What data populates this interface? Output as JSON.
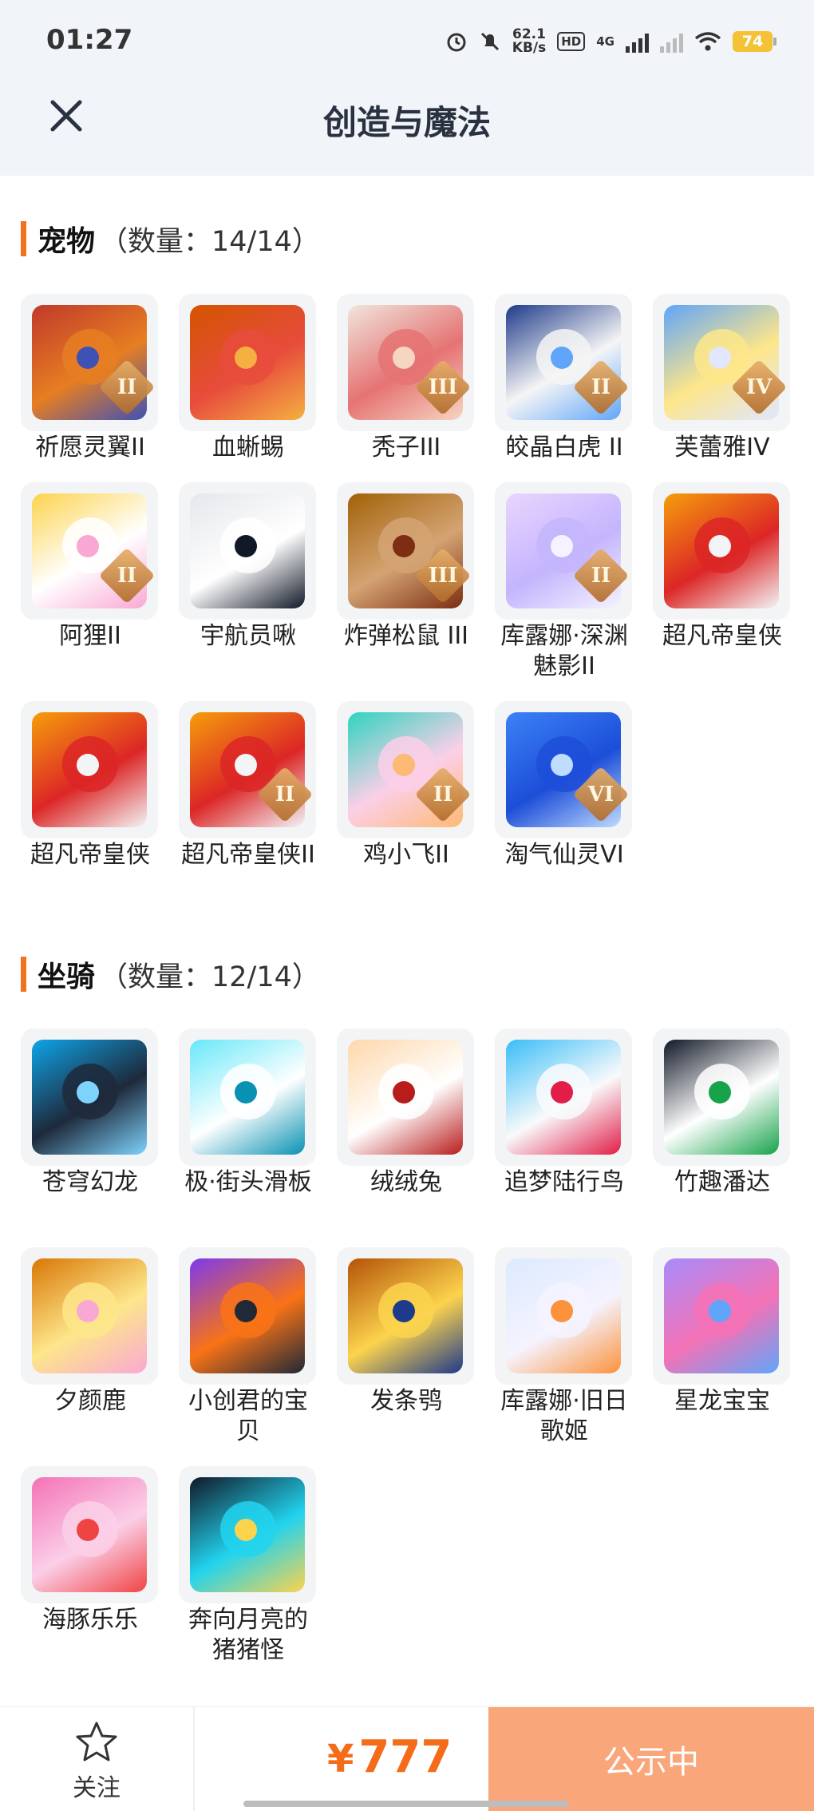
{
  "status_bar": {
    "time": "01:27",
    "net_speed_value": "62.1",
    "net_speed_unit": "KB/s",
    "hd_badge": "HD",
    "network": "4G",
    "battery": "74"
  },
  "header": {
    "title": "创造与魔法",
    "close_icon": "close-icon"
  },
  "pets": {
    "name": "宠物",
    "count_label": "（数量：14/14）",
    "items": [
      {
        "name": "祈愿灵翼II",
        "tier": "II",
        "colors": [
          "#c0392b",
          "#e67e22",
          "#3f51b5"
        ]
      },
      {
        "name": "血蜥蜴",
        "tier": "",
        "colors": [
          "#d35400",
          "#e74c3c",
          "#f5b041"
        ]
      },
      {
        "name": "秃子III",
        "tier": "III",
        "colors": [
          "#f0e6dc",
          "#e57373",
          "#f6d5c1"
        ]
      },
      {
        "name": "皎晶白虎 II",
        "tier": "II",
        "colors": [
          "#1e3a8a",
          "#f5f5f5",
          "#60a5fa"
        ]
      },
      {
        "name": "芙蕾雅IV",
        "tier": "IV",
        "colors": [
          "#60a5fa",
          "#fde68a",
          "#e0e7ff"
        ]
      },
      {
        "name": "阿狸II",
        "tier": "II",
        "colors": [
          "#fcd34d",
          "#ffffff",
          "#f9a8d4"
        ]
      },
      {
        "name": "宇航员啾",
        "tier": "",
        "colors": [
          "#e5e7eb",
          "#ffffff",
          "#111827"
        ]
      },
      {
        "name": "炸弹松鼠 III",
        "tier": "III",
        "colors": [
          "#a16207",
          "#d4a373",
          "#7c2d12"
        ]
      },
      {
        "name": "库露娜·深渊魅影II",
        "tier": "II",
        "colors": [
          "#e9d5ff",
          "#c4b5fd",
          "#f5f3ff"
        ]
      },
      {
        "name": "超凡帝皇侠",
        "tier": "",
        "colors": [
          "#f59e0b",
          "#dc2626",
          "#f3f4f6"
        ]
      },
      {
        "name": "超凡帝皇侠",
        "tier": "",
        "colors": [
          "#f59e0b",
          "#dc2626",
          "#f3f4f6"
        ]
      },
      {
        "name": "超凡帝皇侠II",
        "tier": "II",
        "colors": [
          "#f59e0b",
          "#dc2626",
          "#f3f4f6"
        ]
      },
      {
        "name": "鸡小飞II",
        "tier": "II",
        "colors": [
          "#2dd4bf",
          "#fbcfe8",
          "#fdba74"
        ]
      },
      {
        "name": "淘气仙灵VI",
        "tier": "VI",
        "colors": [
          "#3b82f6",
          "#1d4ed8",
          "#bfdbfe"
        ]
      }
    ]
  },
  "mounts": {
    "name": "坐骑",
    "count_label": "（数量：12/14）",
    "items": [
      {
        "name": "苍穹幻龙",
        "tier": "",
        "colors": [
          "#0ea5e9",
          "#1e293b",
          "#7dd3fc"
        ]
      },
      {
        "name": "极·街头滑板",
        "tier": "",
        "colors": [
          "#67e8f9",
          "#ffffff",
          "#0891b2"
        ]
      },
      {
        "name": "绒绒兔",
        "tier": "",
        "colors": [
          "#fed7aa",
          "#ffffff",
          "#b91c1c"
        ]
      },
      {
        "name": "追梦陆行鸟",
        "tier": "",
        "colors": [
          "#38bdf8",
          "#f9fafb",
          "#e11d48"
        ]
      },
      {
        "name": "竹趣潘达",
        "tier": "",
        "colors": [
          "#111827",
          "#ffffff",
          "#16a34a"
        ]
      },
      {
        "name": "夕颜鹿",
        "tier": "",
        "colors": [
          "#d97706",
          "#fde68a",
          "#f9a8d4"
        ]
      },
      {
        "name": "小创君的宝贝",
        "tier": "",
        "colors": [
          "#7c3aed",
          "#f97316",
          "#1f2937"
        ]
      },
      {
        "name": "发条鸮",
        "tier": "",
        "colors": [
          "#b45309",
          "#fcd34d",
          "#1e3a8a"
        ]
      },
      {
        "name": "库露娜·旧日歌姬",
        "tier": "",
        "colors": [
          "#dbeafe",
          "#f5f3ff",
          "#fb923c"
        ]
      },
      {
        "name": "星龙宝宝",
        "tier": "",
        "colors": [
          "#a78bfa",
          "#f472b6",
          "#60a5fa"
        ]
      },
      {
        "name": "海豚乐乐",
        "tier": "",
        "colors": [
          "#f472b6",
          "#fbcfe8",
          "#ef4444"
        ]
      },
      {
        "name": "奔向月亮的猪猪怪",
        "tier": "",
        "colors": [
          "#111827",
          "#22d3ee",
          "#fcd34d"
        ]
      }
    ]
  },
  "bottom": {
    "follow_label": "关注",
    "currency": "¥",
    "price": "777",
    "status_label": "公示中"
  }
}
